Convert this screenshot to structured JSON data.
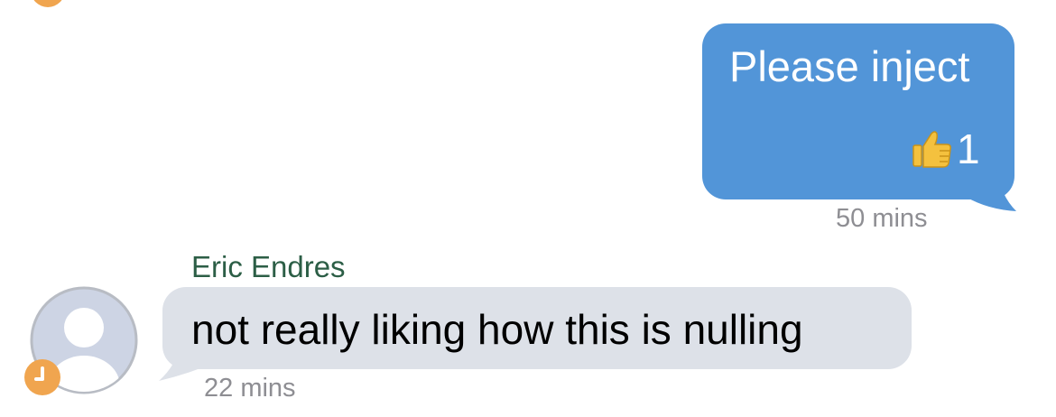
{
  "colors": {
    "outgoing_bubble": "#5295d8",
    "incoming_bubble": "#dde1e8",
    "sender_name": "#2c5e46",
    "timestamp": "#8e8e93",
    "status_badge": "#f0a54f",
    "reaction_thumb": "#f4c13e"
  },
  "messages": [
    {
      "direction": "outgoing",
      "text": "Please inject",
      "reaction": {
        "icon": "thumbs-up-icon",
        "count": "1"
      },
      "time": "50 mins"
    },
    {
      "direction": "incoming",
      "sender": "Eric Endres",
      "avatar_icon": "default-user-icon",
      "status_icon": "clock-icon",
      "text": "not really liking how this is nulling",
      "time": "22 mins"
    }
  ]
}
